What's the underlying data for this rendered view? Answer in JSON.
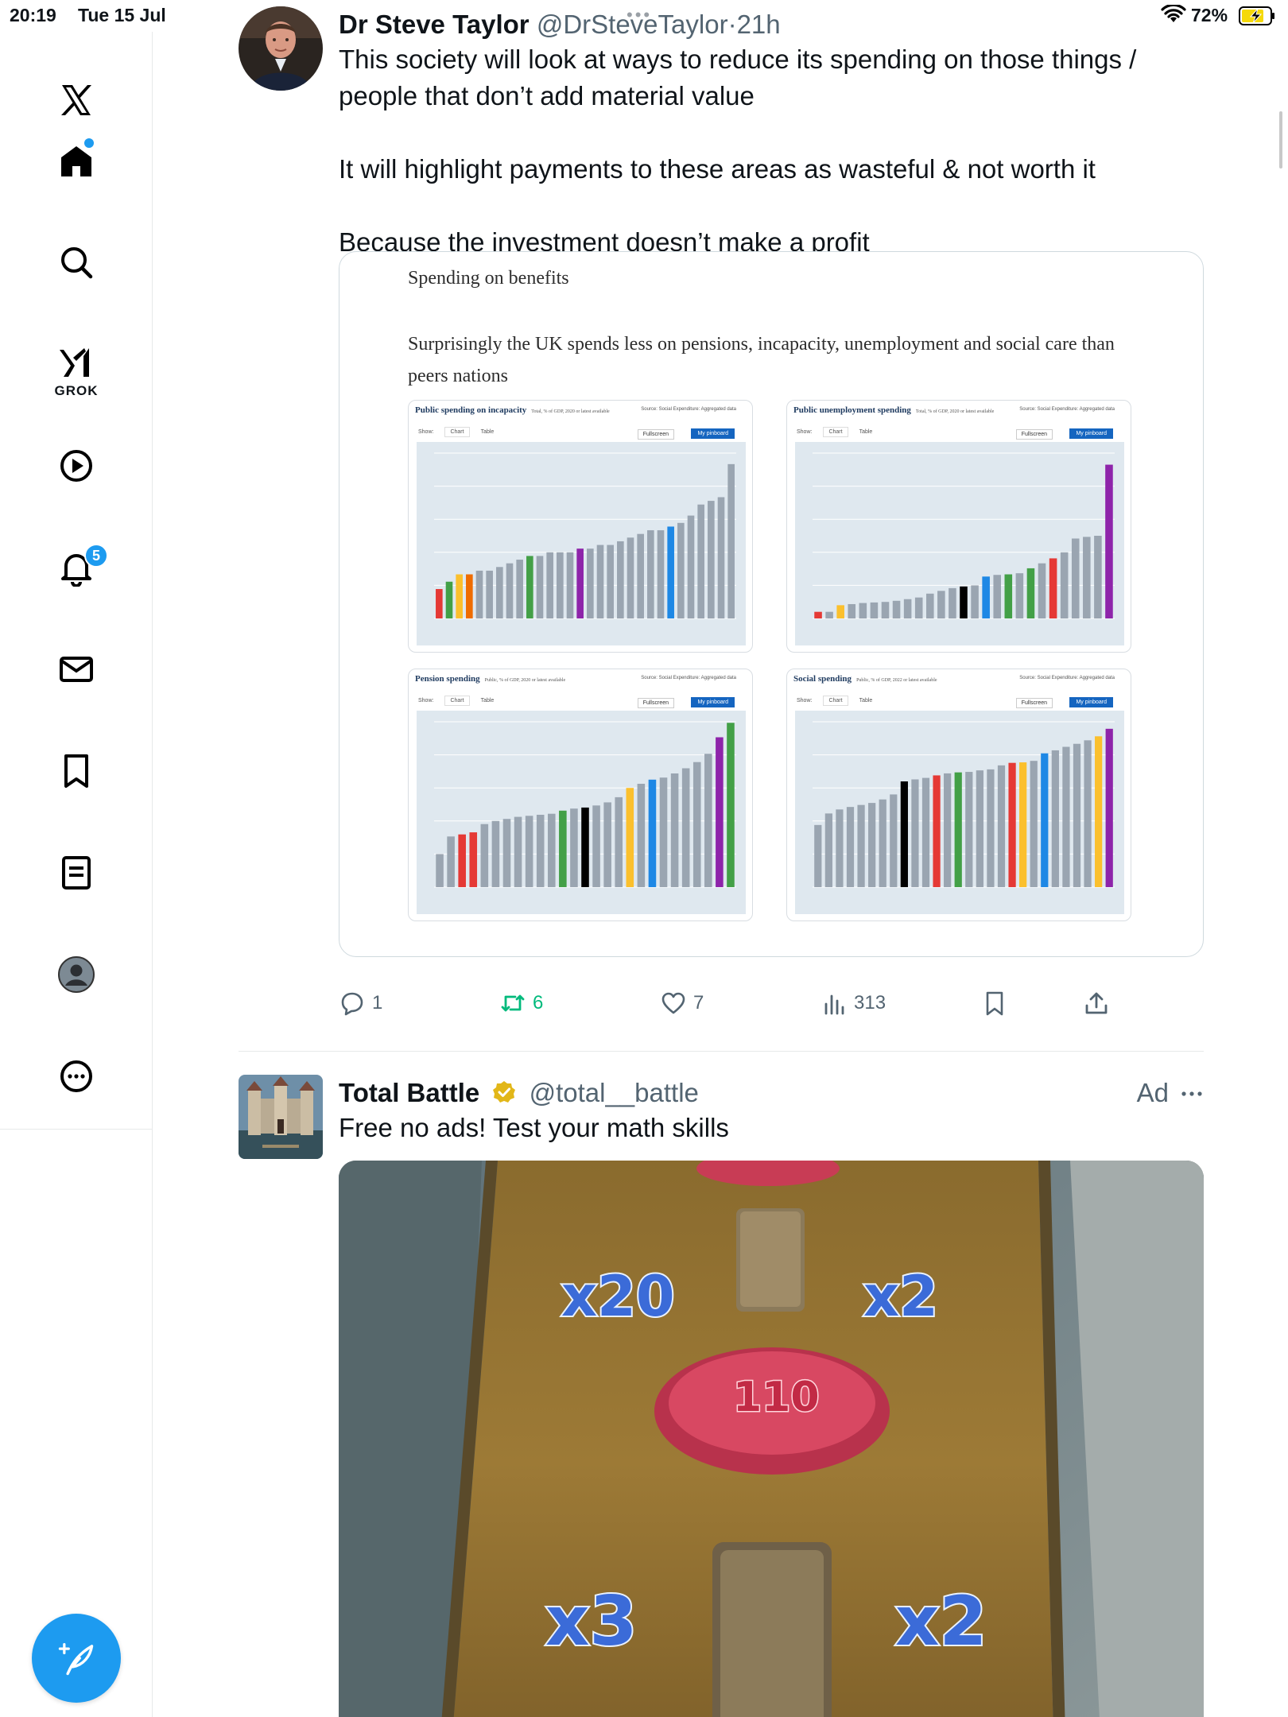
{
  "status_bar": {
    "time": "20:19",
    "date": "Tue 15 Jul",
    "battery": "72%"
  },
  "sidebar": {
    "items": [
      {
        "name": "x-logo",
        "label": "X"
      },
      {
        "name": "home",
        "label": "Home"
      },
      {
        "name": "search",
        "label": "Search"
      },
      {
        "name": "grok",
        "label": "GROK"
      },
      {
        "name": "video",
        "label": "Video"
      },
      {
        "name": "notifications",
        "label": "Notifications",
        "badge": "5"
      },
      {
        "name": "messages",
        "label": "Messages"
      },
      {
        "name": "bookmarks",
        "label": "Bookmarks"
      },
      {
        "name": "articles",
        "label": "Articles"
      },
      {
        "name": "profile",
        "label": "Profile"
      },
      {
        "name": "more",
        "label": "More"
      }
    ],
    "grok_label": "GROK",
    "notifications_badge": "5"
  },
  "tweet1": {
    "author_name": "Dr Steve Taylor",
    "handle": "@DrSteveTaylor",
    "separator": "·",
    "time": "21h",
    "lines": [
      "This society will look at ways to reduce its spending on those things /",
      "people that don’t add material value",
      "It will highlight payments to these areas as wasteful & not worth it",
      "Because the investment doesn’t make a profit"
    ],
    "media": {
      "title": "Spending on benefits",
      "subtitle": "Surprisingly the UK spends less on pensions, incapacity, unemployment and social care than peers nations"
    },
    "stats": {
      "replies": "1",
      "retweets": "6",
      "likes": "7",
      "views": "313"
    }
  },
  "chart_data": [
    {
      "type": "bar",
      "title": "Public spending on incapacity",
      "subtitle": "Total, % of GDP, 2020 or latest available",
      "source": "Source: Social Expenditure: Aggregated data",
      "tabs": [
        "Show:",
        "Chart",
        "Table"
      ],
      "buttons": [
        "Fullscreen",
        "My pinboard"
      ],
      "values": [
        0.8,
        1.0,
        1.2,
        1.2,
        1.3,
        1.3,
        1.4,
        1.5,
        1.6,
        1.7,
        1.7,
        1.8,
        1.8,
        1.8,
        1.9,
        1.9,
        2.0,
        2.0,
        2.1,
        2.2,
        2.3,
        2.4,
        2.4,
        2.5,
        2.6,
        2.8,
        3.1,
        3.2,
        3.3,
        4.2
      ],
      "highlight_colors": {
        "0": "#e53935",
        "1": "#43a047",
        "2": "#fbc02d",
        "3": "#ef6c00",
        "9": "#43a047",
        "14": "#8e24aa",
        "23": "#1e88e5"
      },
      "ylim": [
        0,
        4.5
      ]
    },
    {
      "type": "bar",
      "title": "Public unemployment spending",
      "subtitle": "Total, % of GDP, 2020 or latest available",
      "source": "Source: Social Expenditure: Aggregated data",
      "tabs": [
        "Show:",
        "Chart",
        "Table"
      ],
      "buttons": [
        "Fullscreen",
        "My pinboard"
      ],
      "values": [
        0.12,
        0.12,
        0.24,
        0.26,
        0.28,
        0.29,
        0.3,
        0.32,
        0.35,
        0.38,
        0.45,
        0.5,
        0.55,
        0.58,
        0.6,
        0.76,
        0.79,
        0.8,
        0.82,
        0.91,
        1.0,
        1.09,
        1.2,
        1.45,
        1.48,
        1.5,
        2.79
      ],
      "highlight_colors": {
        "0": "#e53935",
        "2": "#fbc02d",
        "13": "#000000",
        "15": "#1e88e5",
        "17": "#43a047",
        "19": "#43a047",
        "21": "#e53935",
        "26": "#8e24aa"
      },
      "ylim": [
        0,
        3
      ]
    },
    {
      "type": "bar",
      "title": "Pension spending",
      "subtitle": "Public, % of GDP, 2020 or latest available",
      "source": "Source: Social Expenditure: Aggregated data",
      "tabs": [
        "Show:",
        "Chart",
        "Table"
      ],
      "buttons": [
        "Fullscreen",
        "My pinboard"
      ],
      "values": [
        3.2,
        4.9,
        5.1,
        5.3,
        6.1,
        6.4,
        6.6,
        6.8,
        6.9,
        7.0,
        7.1,
        7.4,
        7.6,
        7.7,
        7.9,
        8.2,
        8.7,
        9.6,
        10.0,
        10.4,
        10.6,
        11.0,
        11.5,
        12.1,
        12.9,
        14.5,
        15.9
      ],
      "highlight_colors": {
        "2": "#e53935",
        "3": "#e53935",
        "11": "#43a047",
        "13": "#000000",
        "17": "#fbc02d",
        "19": "#1e88e5",
        "25": "#8e24aa",
        "26": "#43a047"
      },
      "ylim": [
        0,
        16
      ]
    },
    {
      "type": "bar",
      "title": "Social spending",
      "subtitle": "Public, % of GDP, 2022 or latest available",
      "source": "Source: Social Expenditure: Aggregated data",
      "tabs": [
        "Show:",
        "Chart",
        "Table"
      ],
      "buttons": [
        "Fullscreen",
        "My pinboard"
      ],
      "values": [
        12.4,
        14.7,
        15.5,
        16.0,
        16.4,
        16.8,
        17.5,
        18.5,
        21.1,
        21.5,
        21.8,
        22.3,
        22.7,
        22.9,
        23.0,
        23.3,
        23.5,
        24.3,
        24.8,
        24.9,
        25.2,
        26.7,
        27.3,
        28.0,
        28.6,
        29.3,
        30.1,
        31.6
      ],
      "highlight_colors": {
        "8": "#000000",
        "11": "#e53935",
        "13": "#43a047",
        "18": "#e53935",
        "19": "#fbc02d",
        "21": "#1e88e5",
        "26": "#fbc02d",
        "27": "#8e24aa"
      },
      "ylim": [
        0,
        33
      ]
    }
  ],
  "tweet2": {
    "author_name": "Total Battle",
    "handle": "@total__battle",
    "ad_label": "Ad",
    "text": "Free no ads! Test your math skills",
    "game": {
      "top_left": "x20",
      "top_right": "x2",
      "count": "110",
      "bottom_left": "x3",
      "bottom_right": "x2"
    }
  },
  "colors": {
    "accent": "#1d9bf0",
    "retweet_green": "#00ba7c",
    "text_secondary": "#536471"
  }
}
